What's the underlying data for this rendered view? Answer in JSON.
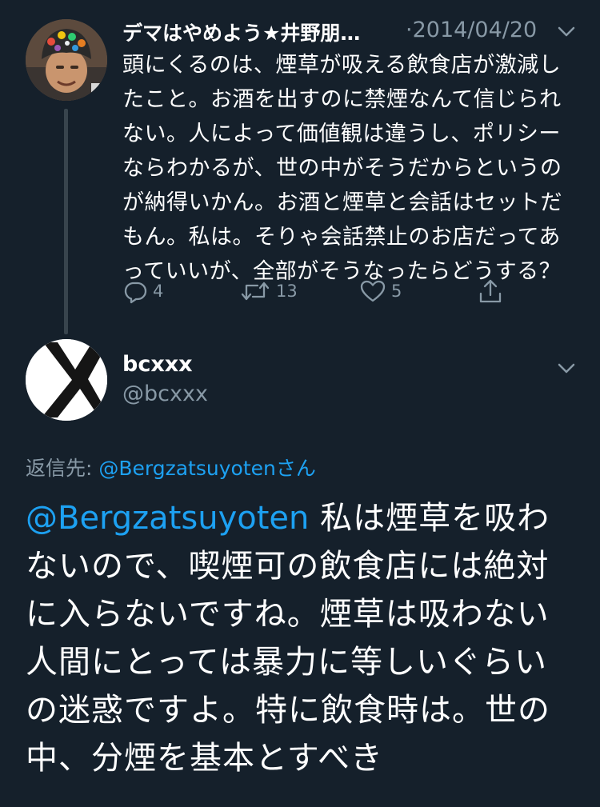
{
  "parent_tweet": {
    "display_name": "デマはやめよう★井野朋…",
    "date": "·2014/04/20",
    "text": "頭にくるのは、煙草が吸える飲食店が激減したこと。お酒を出すのに禁煙なんて信じられない。人によって価値観は違うし、ポリシーならわかるが、世の中がそうだからというのが納得いかん。お酒と煙草と会話はセットだもん。私は。そりゃ会話禁止のお店だってあっていいが、全部がそうなったらどうする？",
    "icons": {
      "avatar": "user-avatar-colorful-bandana",
      "menu": "chevron-down-icon"
    },
    "actions": {
      "reply_count": "4",
      "retweet_count": "13",
      "like_count": "5"
    }
  },
  "reply_tweet": {
    "display_name": "bcxxx",
    "handle": "@bcxxx",
    "replying_to_label": "返信先: ",
    "replying_to_mention": "@Bergzatsuyoten",
    "replying_to_suffix": "さん",
    "mention": "@Bergzatsuyoten",
    "text": " 私は煙草を吸わないので、喫煙可の飲食店には絶対に入らないですね。煙草は吸わない人間にとっては暴力に等しいぐらいの迷惑ですよ。特に飲食時は。世の中、分煙を基本とすべき",
    "icons": {
      "avatar": "x-avatar-icon"
    }
  },
  "colors": {
    "background": "#15202b",
    "text": "#ffffff",
    "secondary": "#8899a6",
    "link": "#1da1f2",
    "thread_line": "#38444d"
  }
}
